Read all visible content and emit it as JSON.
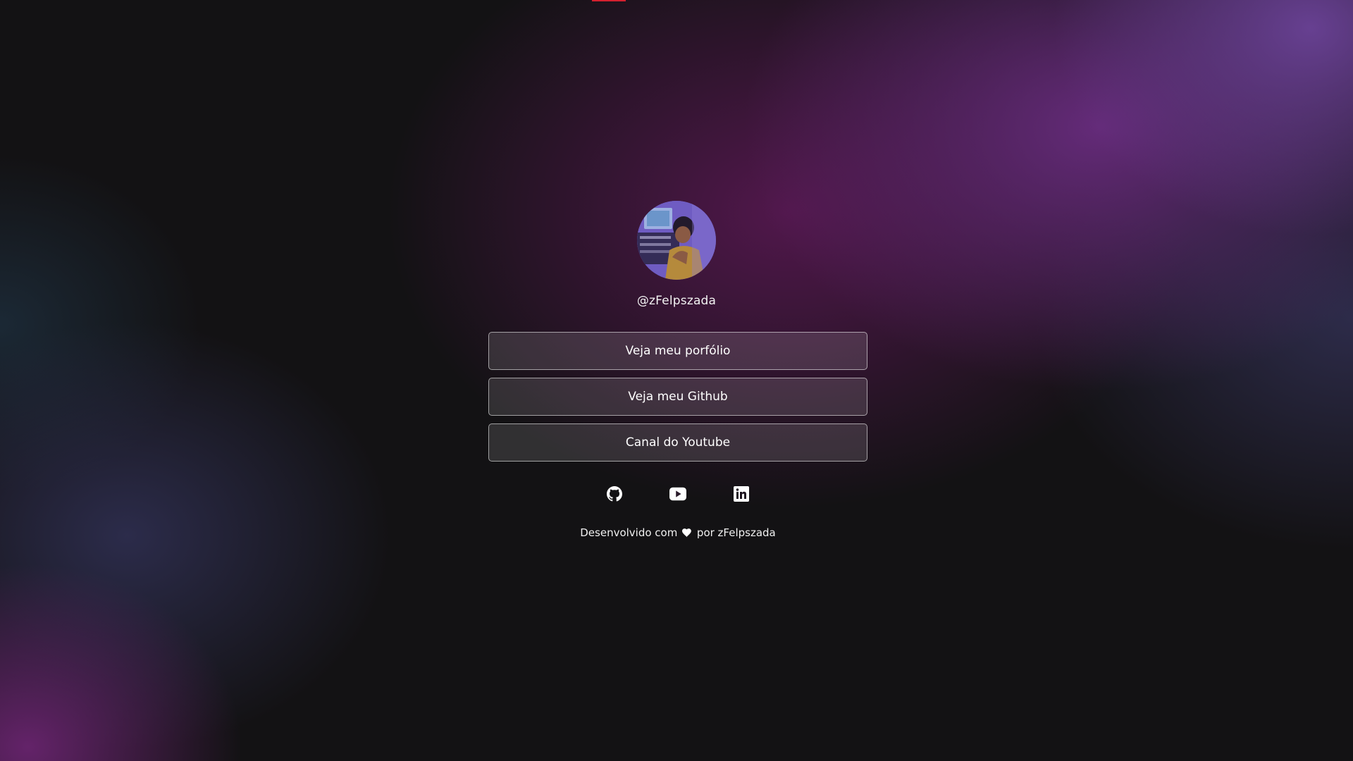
{
  "profile": {
    "handle": "@zFelpszada"
  },
  "links": [
    {
      "label": "Veja meu porfólio"
    },
    {
      "label": "Veja meu Github"
    },
    {
      "label": "Canal do Youtube"
    }
  ],
  "socials": [
    {
      "icon": "github-icon"
    },
    {
      "icon": "youtube-icon"
    },
    {
      "icon": "linkedin-icon"
    }
  ],
  "footer": {
    "prefix": "Desenvolvido com",
    "icon": "heart-icon",
    "suffix": "por zFelpszada"
  },
  "colors": {
    "background": "#131214",
    "accent_purple": "#682c7e",
    "top_indicator": "#d4202e"
  }
}
